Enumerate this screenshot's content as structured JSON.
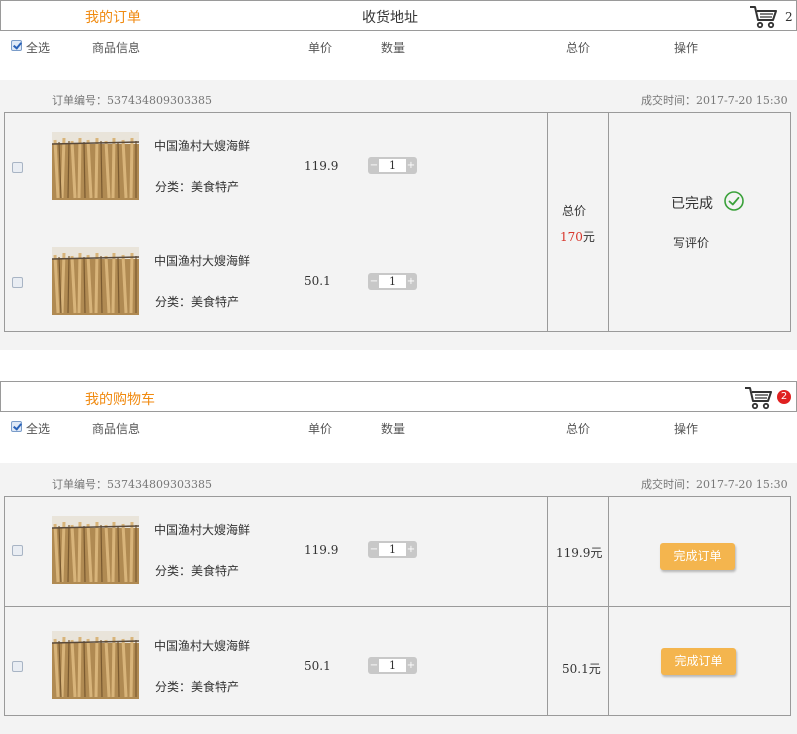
{
  "my_orders": {
    "tab_title": "我的订单",
    "address_title": "收货地址",
    "cart_count": "2"
  },
  "my_cart": {
    "title": "我的购物车",
    "cart_count": "2"
  },
  "headers": {
    "select_all": "全选",
    "product_info": "商品信息",
    "unit_price": "单价",
    "quantity": "数量",
    "total": "总价",
    "action": "操作"
  },
  "order1": {
    "order_no": "订单编号：537434809303385",
    "deal_time": "成交时间：2017-7-20 15:30",
    "items": [
      {
        "name": "中国渔村大嫂海鲜",
        "category": "分类：美食特产",
        "price": "119.9",
        "qty": "1"
      },
      {
        "name": "中国渔村大嫂海鲜",
        "category": "分类：美食特产",
        "price": "50.1",
        "qty": "1"
      }
    ],
    "total_label": "总价",
    "total_amount": "170",
    "total_unit": "元",
    "status": "已完成",
    "review_link": "写评价"
  },
  "order2": {
    "order_no": "订单编号：537434809303385",
    "deal_time": "成交时间：2017-7-20 15:30",
    "items": [
      {
        "name": "中国渔村大嫂海鲜",
        "category": "分类：美食特产",
        "price": "119.9",
        "qty": "1",
        "total": "119.9元",
        "button": "完成订单"
      },
      {
        "name": "中国渔村大嫂海鲜",
        "category": "分类：美食特产",
        "price": "50.1",
        "qty": "1",
        "total": "50.1元",
        "button": "完成订单"
      }
    ]
  },
  "stepper": {
    "minus": "−",
    "plus": "+"
  },
  "icons": [
    "cart-icon",
    "check-circle-icon",
    "checkbox-icon"
  ],
  "colors": {
    "accent_orange": "#f08a10",
    "price_red": "#d8352a",
    "button_orange": "#f4b54e",
    "badge_red": "#e02020",
    "success_green": "#3aa13a"
  }
}
